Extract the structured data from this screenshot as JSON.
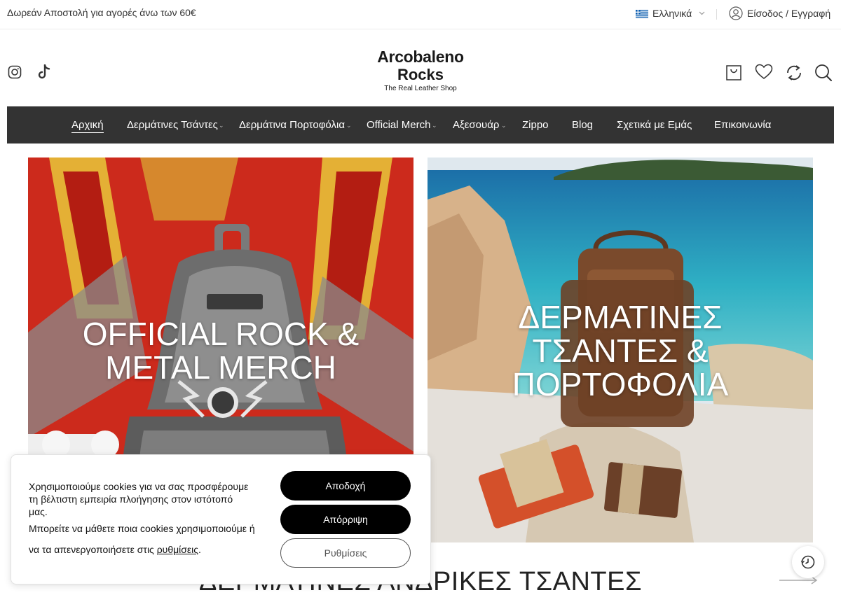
{
  "topbar": {
    "promo": "Δωρεάν Αποστολή για αγορές άνω των 60€",
    "language": "Ελληνικά",
    "login": "Είσοδος / Εγγραφή"
  },
  "logo": {
    "line1": "Arcobaleno",
    "line2": "Rocks",
    "tagline": "The Real Leather Shop"
  },
  "nav": {
    "items": [
      {
        "label": "Αρχική"
      },
      {
        "label": "Δερμάτινες Τσάντες"
      },
      {
        "label": "Δερμάτινα Πορτοφόλια"
      },
      {
        "label": "Official Merch"
      },
      {
        "label": "Αξεσουάρ"
      },
      {
        "label": "Zippo"
      },
      {
        "label": "Blog"
      },
      {
        "label": "Σχετικά με Εμάς"
      },
      {
        "label": "Επικοινωνία"
      }
    ]
  },
  "banners": {
    "left": {
      "line1": "OFFICIAL ROCK &",
      "line2": "METAL MERCH"
    },
    "right": {
      "line1": "ΔΕΡΜΑΤΙΝΕΣ",
      "line2": "ΤΣΑΝΤΕΣ &",
      "line3": "ΠΟΡΤΟΦΟΛΙΑ"
    }
  },
  "section": {
    "title": "ΔΕΡΜΑΤΙΝΕΣ ΑΝΔΡΙΚΕΣ ΤΣΑΝΤΕΣ"
  },
  "cookie": {
    "text1": "Χρησιμοποιούμε cookies για να σας προσφέρουμε τη βέλτιστη εμπειρία πλοήγησης στον ιστότοπό μας.",
    "text2_a": "Μπορείτε να μάθετε ποια cookies χρησιμοποιούμε ή να τα απενεργοποιήσετε στις ",
    "text2_link": "ρυθμίσεις",
    "text2_end": ".",
    "accept": "Αποδοχή",
    "reject": "Απόρριψη",
    "settings": "Ρυθμίσεις"
  },
  "icons": {
    "social": [
      "instagram-icon",
      "tiktok-icon"
    ],
    "header": [
      "cart-icon",
      "heart-icon",
      "compare-icon",
      "search-icon"
    ],
    "floating": "history-icon"
  },
  "colors": {
    "nav_bg": "#333333",
    "button_dark": "#000000"
  }
}
